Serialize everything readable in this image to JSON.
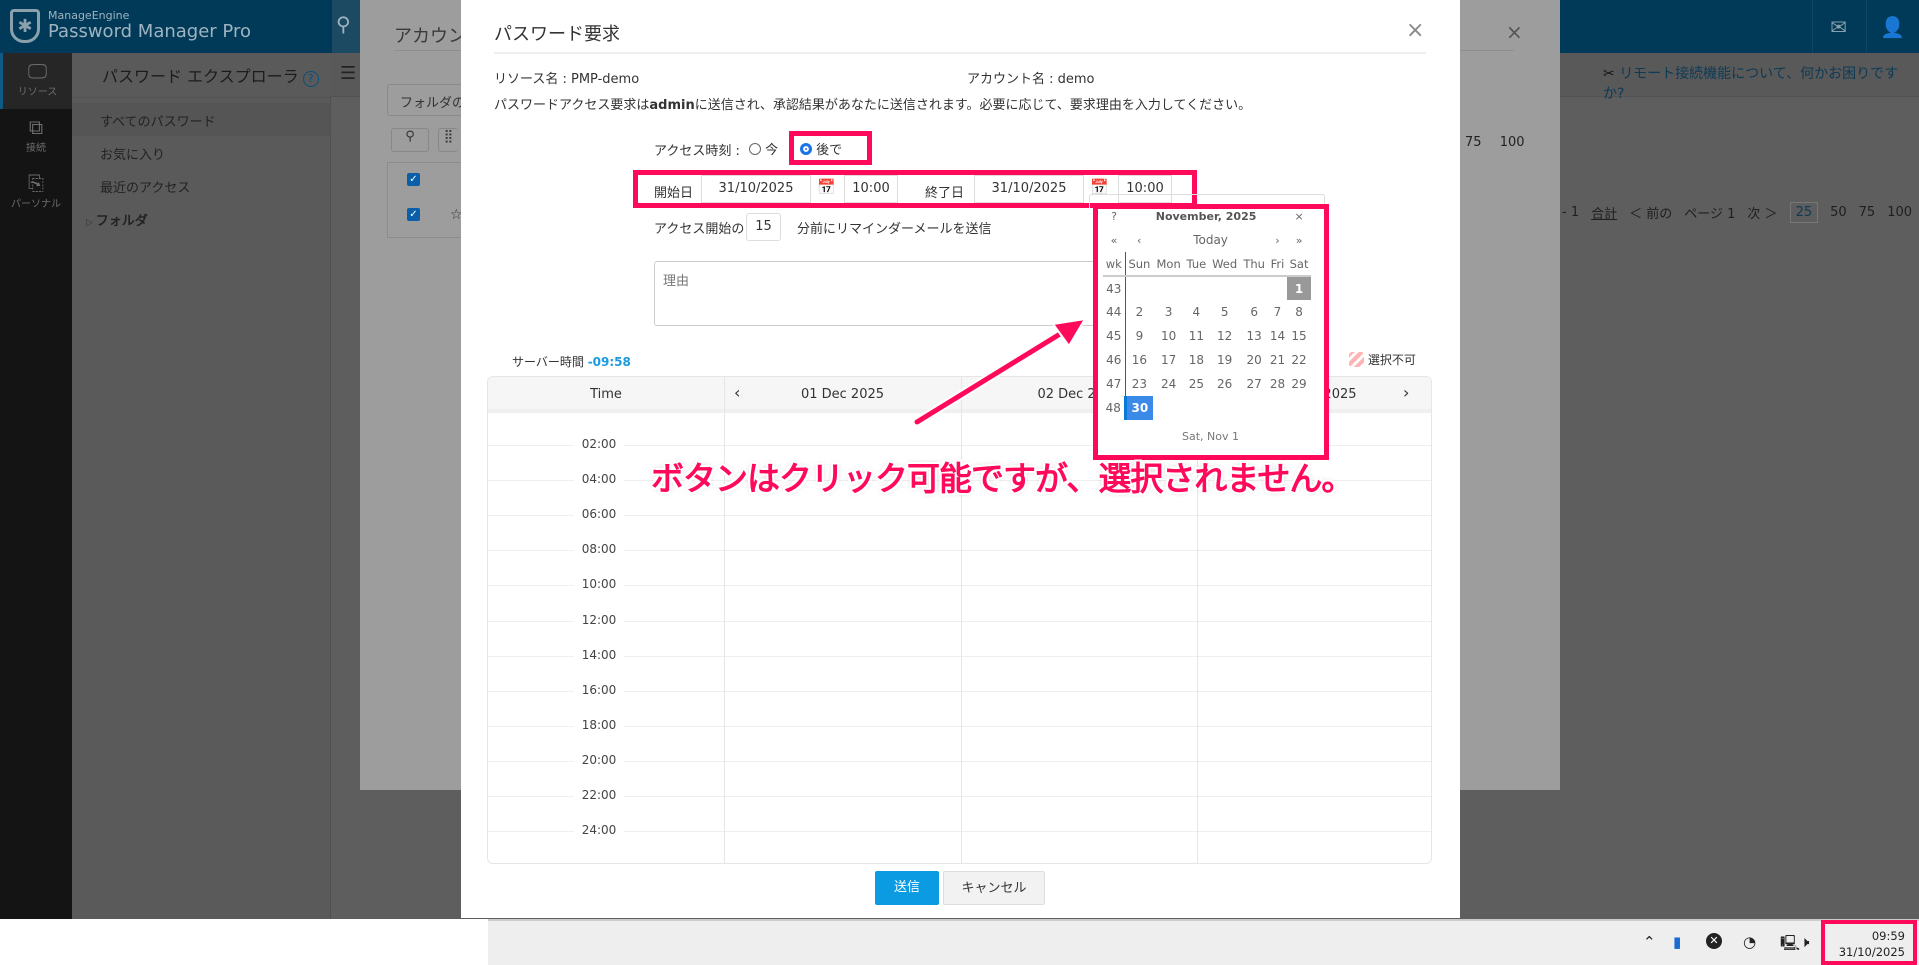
{
  "app": {
    "brand_top": "ManageEngine",
    "brand_name": "Password Manager Pro"
  },
  "iconbar": [
    {
      "label": "リソース",
      "icon": "monitor-icon"
    },
    {
      "label": "接続",
      "icon": "connection-icon"
    },
    {
      "label": "パーソナル",
      "icon": "contact-book-icon"
    }
  ],
  "panel": {
    "title": "パスワード エクスプローラ",
    "help": "?",
    "items": [
      "すべてのパスワード",
      "お気に入り",
      "最近のアクセス",
      "フォルダ"
    ]
  },
  "main": {
    "help_link": "リモート接続機能について、何かお困りですか?",
    "pager": {
      "range": "- 1",
      "total": "合計",
      "prev": "＜ 前の",
      "page": "ページ 1",
      "next": "次 ＞",
      "sizes": [
        "25",
        "50",
        "75",
        "100"
      ]
    }
  },
  "back_modal": {
    "title": "アカウン",
    "folder": "フォルダの",
    "sizes": [
      "75",
      "100"
    ]
  },
  "modal": {
    "title": "パスワード要求",
    "close": "×",
    "resource": "リソース名 : PMP-demo",
    "account": "アカウント名 : demo",
    "desc_pre": "パスワードアクセス要求は",
    "desc_admin": "admin",
    "desc_post": "に送信され、承認結果があなたに送信されます。必要に応じて、要求理由を入力してください。",
    "access_label": "アクセス時刻 :",
    "opt_now": "今",
    "opt_later": "後で",
    "start_label": "開始日",
    "start_date": "31/10/2025",
    "start_time": "10:00",
    "end_label": "終了日",
    "end_date": "31/10/2025",
    "end_time": "10:00",
    "reminder_pre": "アクセス開始の",
    "reminder_value": "15",
    "reminder_post": "分前にリマインダーメールを送信",
    "reason_placeholder": "理由",
    "server_time_label": "サーバー時間 ",
    "server_time": "-09:58",
    "unavailable": "選択不可",
    "submit": "送信",
    "cancel": "キャンセル"
  },
  "scheduler": {
    "time_header": "Time",
    "days": [
      "01 Dec 2025",
      "02 Dec 2025",
      "03 Dec 2025"
    ],
    "times": [
      "02:00",
      "04:00",
      "06:00",
      "08:00",
      "10:00",
      "12:00",
      "14:00",
      "16:00",
      "18:00",
      "20:00",
      "22:00",
      "24:00"
    ]
  },
  "calendar": {
    "help": "?",
    "month": "November, 2025",
    "close": "×",
    "nav": [
      "«",
      "‹",
      "Today",
      "›",
      "»"
    ],
    "dow": [
      "wk",
      "Sun",
      "Mon",
      "Tue",
      "Wed",
      "Thu",
      "Fri",
      "Sat"
    ],
    "weeks": [
      [
        "43",
        "",
        "",
        "",
        "",
        "",
        "",
        "1"
      ],
      [
        "44",
        "2",
        "3",
        "4",
        "5",
        "6",
        "7",
        "8"
      ],
      [
        "45",
        "9",
        "10",
        "11",
        "12",
        "13",
        "14",
        "15"
      ],
      [
        "46",
        "16",
        "17",
        "18",
        "19",
        "20",
        "21",
        "22"
      ],
      [
        "47",
        "23",
        "24",
        "25",
        "26",
        "27",
        "28",
        "29"
      ],
      [
        "48",
        "30",
        "",
        "",
        "",
        "",
        "",
        ""
      ]
    ],
    "footer": "Sat, Nov 1"
  },
  "annotation": "ボタンはクリック可能ですが、選択されません。",
  "taskbar": {
    "time": "09:59",
    "date": "31/10/2025"
  }
}
